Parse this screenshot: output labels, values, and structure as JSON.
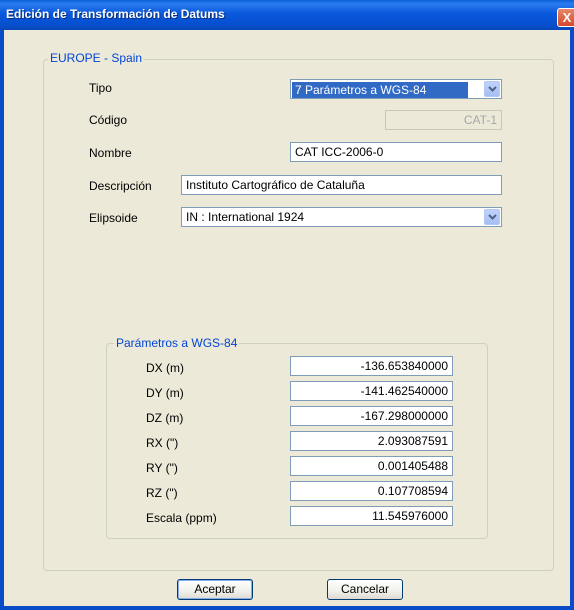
{
  "window": {
    "title": "Edición de Transformación de Datums",
    "close_glyph": "X"
  },
  "region_group": {
    "legend": "EUROPE - Spain",
    "fields": {
      "tipo": {
        "label": "Tipo",
        "value": "7 Parámetros a WGS-84"
      },
      "codigo": {
        "label": "Código",
        "value": "CAT-1"
      },
      "nombre": {
        "label": "Nombre",
        "value": "CAT ICC-2006-0"
      },
      "descripcion": {
        "label": "Descripción",
        "value": "Instituto Cartográfico de Cataluña"
      },
      "elipsoide": {
        "label": "Elipsoide",
        "value": "IN : International 1924"
      }
    }
  },
  "params_group": {
    "legend": "Parámetros a WGS-84",
    "rows": [
      {
        "label": "DX (m)",
        "value": "-136.653840000"
      },
      {
        "label": "DY (m)",
        "value": "-141.462540000"
      },
      {
        "label": "DZ (m)",
        "value": "-167.298000000"
      },
      {
        "label": "RX (\")",
        "value": "2.093087591"
      },
      {
        "label": "RY (\")",
        "value": "0.001405488"
      },
      {
        "label": "RZ (\")",
        "value": "0.107708594"
      },
      {
        "label": "Escala (ppm)",
        "value": "11.545976000"
      }
    ]
  },
  "buttons": {
    "accept": "Aceptar",
    "cancel": "Cancelar"
  },
  "icons": {
    "dropdown": "chevron-down-icon",
    "close": "close-icon"
  }
}
